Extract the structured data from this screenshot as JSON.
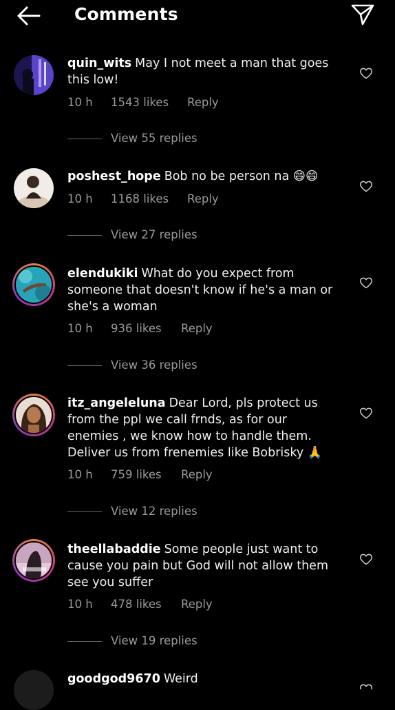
{
  "header": {
    "title": "Comments",
    "back_icon": "arrow-left-icon",
    "share_icon": "paper-plane-icon"
  },
  "comments": [
    {
      "username": "quin_wits",
      "text": "May I not meet a man that goes this low!",
      "time": "10 h",
      "likes": "1543 likes",
      "reply": "Reply",
      "view_replies": "View 55 replies",
      "avatar_colors": [
        "#2b1d6b",
        "#6a4fd6",
        "#c9a3ff"
      ]
    },
    {
      "username": "poshest_hope",
      "text": "Bob no be person na 😄😄",
      "time": "10 h",
      "likes": "1168 likes",
      "reply": "Reply",
      "view_replies": "View 27 replies",
      "avatar_colors": [
        "#f3efe9",
        "#d9c9b6",
        "#3a2a22"
      ]
    },
    {
      "username": "elendukiki",
      "text": "What do you expect from someone that doesn't know if he's a man or she's a woman",
      "time": "10 h",
      "likes": "936 likes",
      "reply": "Reply",
      "view_replies": "View 36 replies",
      "avatar_colors": [
        "#1fa0b8",
        "#5ed3d8",
        "#1b5b6e"
      ]
    },
    {
      "username": "itz_angeleluna",
      "text": "Dear Lord, pls protect us from the ppl we call frnds, as for our enemies , we know how to handle them. Deliver us from frenemies like Bobrisky 🙏",
      "time": "10 h",
      "likes": "759 likes",
      "reply": "Reply",
      "view_replies": "View 12 replies",
      "avatar_colors": [
        "#3a2418",
        "#b07850",
        "#e8c9b4"
      ]
    },
    {
      "username": "theellabaddie",
      "text": "Some people just want to cause you pain but God will not allow them see you suffer",
      "time": "10 h",
      "likes": "478 likes",
      "reply": "Reply",
      "view_replies": "View 19 replies",
      "avatar_colors": [
        "#b58fae",
        "#e3c3d6",
        "#2a1c24"
      ]
    },
    {
      "username": "goodgod9670",
      "text": "Weird",
      "time": "",
      "likes": "",
      "reply": "",
      "view_replies": "",
      "avatar_colors": [
        "#222",
        "#333",
        "#444"
      ]
    }
  ]
}
